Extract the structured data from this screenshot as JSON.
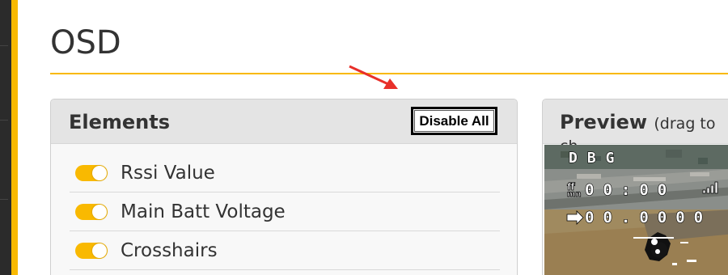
{
  "page": {
    "title": "OSD",
    "accent_color": "#f9b901"
  },
  "elements_panel": {
    "title": "Elements",
    "disable_all_label": "Disable All",
    "items": [
      {
        "label": "Rssi Value",
        "enabled": true
      },
      {
        "label": "Main Batt Voltage",
        "enabled": true
      },
      {
        "label": "Crosshairs",
        "enabled": true
      }
    ]
  },
  "preview_panel": {
    "title": "Preview",
    "hint": "(drag to ch",
    "osd_readouts": {
      "row1": "DBG",
      "row2": "00:00",
      "row3": "00.0000"
    }
  },
  "annotation": {
    "arrow_color": "#e8302a"
  }
}
